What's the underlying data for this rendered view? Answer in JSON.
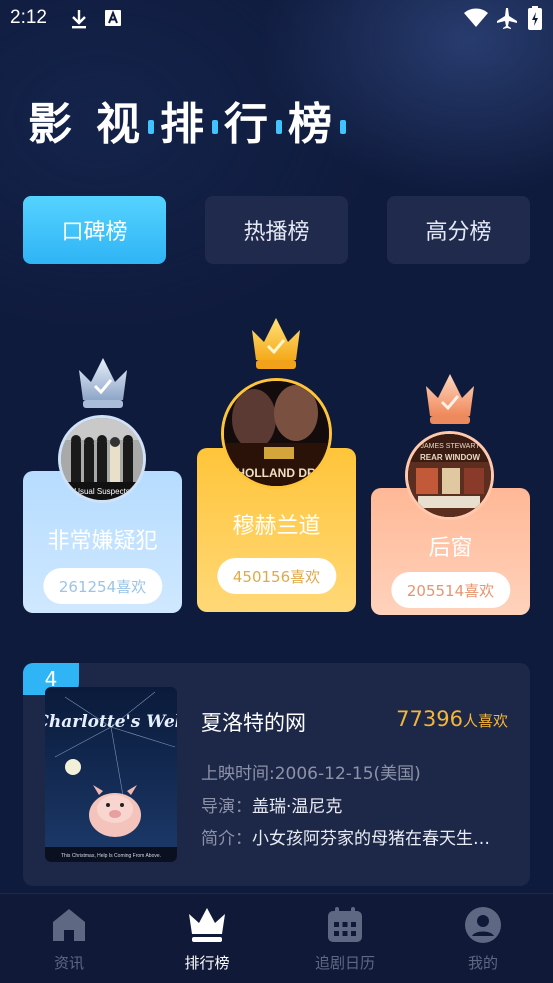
{
  "status_bar": {
    "time": "2:12",
    "icons": [
      "download-icon",
      "a-icon",
      "wifi-icon",
      "airplane-icon",
      "battery-icon"
    ]
  },
  "page": {
    "title_chars": [
      "影",
      "视",
      "排",
      "行",
      "榜"
    ]
  },
  "tabs": [
    {
      "label": "口碑榜",
      "active": true
    },
    {
      "label": "热播榜",
      "active": false
    },
    {
      "label": "高分榜",
      "active": false
    }
  ],
  "podium": {
    "first": {
      "rank": 1,
      "title": "穆赫兰道",
      "likes": "450156喜欢",
      "crown": "gold",
      "poster_text": "HOLLAND DR"
    },
    "second": {
      "rank": 2,
      "title": "非常嫌疑犯",
      "likes": "261254喜欢",
      "crown": "silver",
      "poster_text": "Usual Suspects"
    },
    "third": {
      "rank": 3,
      "title": "后窗",
      "likes": "205514喜欢",
      "crown": "bronze",
      "poster_text": "REAR WINDOW",
      "poster_sub": "JAMES STEWART"
    }
  },
  "list": [
    {
      "rank": "4",
      "title": "夏洛特的网",
      "likes_num": "77396",
      "likes_unit": "人喜欢",
      "release_label": "上映时间:",
      "release_value": "2006-12-15(美国)",
      "director_label": "导演：",
      "director": "盖瑞·温尼克",
      "intro_label": "简介：",
      "intro": "小女孩阿芬家的母猪在春天生…",
      "poster_title": "Charlotte's Web",
      "poster_tagline": "This Christmas, Help Is Coming From Above."
    }
  ],
  "tabbar": [
    {
      "label": "资讯",
      "icon": "home-icon",
      "active": false
    },
    {
      "label": "排行榜",
      "icon": "crown-icon",
      "active": true
    },
    {
      "label": "追剧日历",
      "icon": "calendar-icon",
      "active": false
    },
    {
      "label": "我的",
      "icon": "user-icon",
      "active": false
    }
  ],
  "colors": {
    "background": "#0f1b3d",
    "accent": "#2fb4f5",
    "gold": "#f5b53a",
    "silver_card": "#b9dcff",
    "gold_card": "#ffc94d",
    "bronze_card": "#ffc0a0"
  }
}
